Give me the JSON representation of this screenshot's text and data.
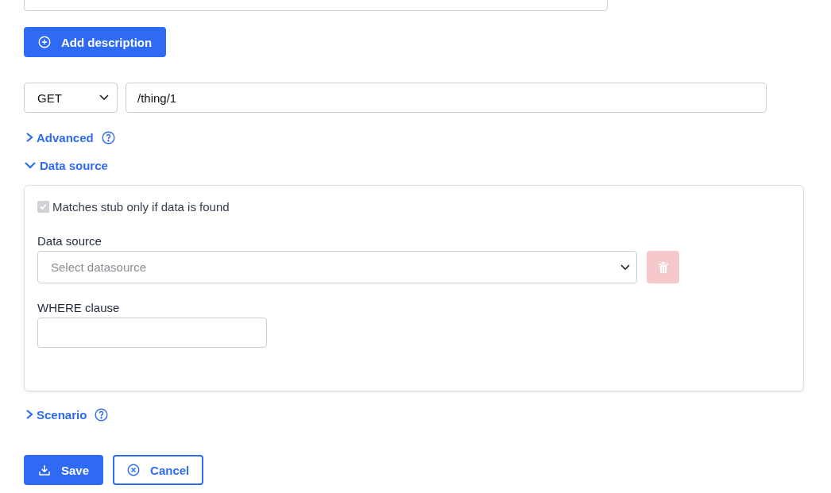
{
  "add_description_button": {
    "label": "Add description"
  },
  "request": {
    "method": "GET",
    "url": "/thing/1"
  },
  "sections": [
    {
      "label": "Advanced",
      "expanded": false,
      "help": true
    },
    {
      "label": "Data source",
      "expanded": true,
      "help": false,
      "content": {
        "match_option": {
          "label": "Matches stub only if data is found",
          "checked": true,
          "disabled": true
        },
        "data_source": {
          "label": "Data source",
          "placeholder": "Select datasource"
        },
        "delete_button": {
          "disabled": true
        },
        "where_clause": {
          "label": "WHERE clause"
        }
      }
    },
    {
      "label": "Scenario",
      "expanded": false,
      "help": true
    }
  ],
  "actions": [
    {
      "kind": "primary",
      "label": "Save"
    },
    {
      "kind": "secondary",
      "label": "Cancel"
    }
  ]
}
